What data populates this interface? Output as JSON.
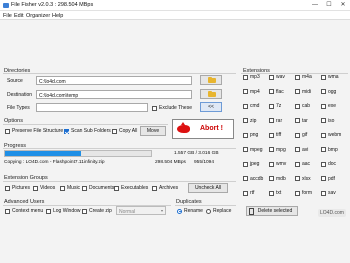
{
  "window": {
    "title": "File Fisher v2.0.3 : 298.504 MBps",
    "controls": {
      "minimize": "—",
      "maximize": "☐",
      "close": "✕"
    }
  },
  "menu": [
    "File",
    "Edit",
    "Organizer",
    "Help"
  ],
  "directories": {
    "label": "Directories",
    "source_label": "Source",
    "source_value": "C:\\lo4d.com",
    "destination_label": "Destination",
    "destination_value": "C:\\lo4d.com\\temp",
    "filetypes_label": "File Types",
    "filetypes_value": "",
    "exclude_label": "Exclude These",
    "move_button": "<<"
  },
  "options": {
    "label": "Options",
    "preserve_label": "Preserve File Structure",
    "preserve_checked": false,
    "scan_sub_label": "Scan Sub Folders",
    "scan_sub_checked": true,
    "copy_all_label": "Copy All",
    "copy_all_checked": false,
    "move_label": "Move"
  },
  "abort": {
    "label": "Abort !"
  },
  "progress": {
    "label": "Progress",
    "fraction": 0.52,
    "size_text": "1.557 GB / 3.016 GB",
    "copying_text": "Copying : LO4D.com - Flashpoint7.11infinity.zip",
    "speed_text": "298.504 MBps",
    "count_text": "955/1094"
  },
  "extension_groups": {
    "label": "Extension Groups",
    "items": [
      {
        "label": "Pictures",
        "checked": false
      },
      {
        "label": "Videos",
        "checked": false
      },
      {
        "label": "Music",
        "checked": false
      },
      {
        "label": "Documents",
        "checked": false
      },
      {
        "label": "Executables",
        "checked": false
      },
      {
        "label": "Archives",
        "checked": false
      }
    ],
    "uncheck_all": "Uncheck All"
  },
  "advanced": {
    "label": "Advanced Users",
    "context_menu": "Context menu",
    "log_window": "Log Window",
    "create_zip": "Create zip",
    "zip_mode": "Normal"
  },
  "duplicates": {
    "label": "Duplicates",
    "rename": "Rename",
    "replace": "Replace",
    "selected": "rename"
  },
  "extensions": {
    "label": "Extensions",
    "columns": [
      [
        "mp3",
        "mp4",
        "cmd",
        "zip",
        "png",
        "mpeg",
        "jpeg",
        "accdb",
        "rtf"
      ],
      [
        "wav",
        "flac",
        "7z",
        "rar",
        "tiff",
        "mpg",
        "wmv",
        "mdb",
        "txt"
      ],
      [
        "m4a",
        "midi",
        "cab",
        "tar",
        "gif",
        "avi",
        "aac",
        "xlsx",
        "form"
      ],
      [
        "wma",
        "ogg",
        "exe",
        "iso",
        "webm",
        "bmp",
        "doc",
        "pdf",
        "sav"
      ]
    ],
    "delete_selected": "Delete selected"
  },
  "watermark": "LO4D.com",
  "colors": {
    "accent": "#1f8fe6",
    "abort_red": "#c00000",
    "folder": "#e8b52f"
  }
}
